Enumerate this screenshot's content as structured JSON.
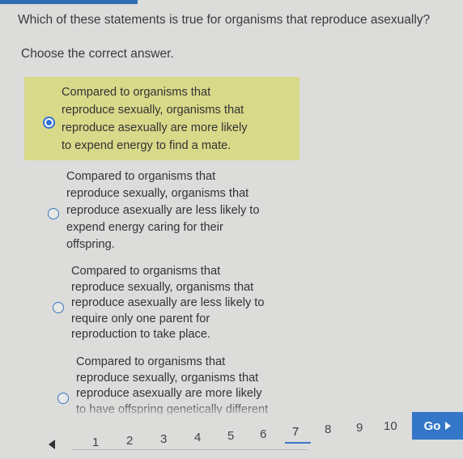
{
  "question": "Which of these statements is true for organisms that reproduce asexually?",
  "instruction": "Choose the correct answer.",
  "choices": [
    {
      "text": "Compared to organisms that\nreproduce sexually, organisms that\nreproduce asexually are more likely\nto expend energy to find a mate.",
      "selected": true
    },
    {
      "text": "Compared to organisms that\nreproduce sexually, organisms that\nreproduce asexually are less likely to\nexpend energy caring for their\noffspring.",
      "selected": false
    },
    {
      "text": "Compared to organisms that\nreproduce sexually, organisms that\nreproduce asexually are less likely to\nrequire only one parent for\nreproduction to take place.",
      "selected": false
    },
    {
      "text": "Compared to organisms that\nreproduce sexually, organisms that\nreproduce asexually are more likely\nto have offspring genetically different",
      "selected": false
    }
  ],
  "pagination": {
    "pages": [
      "1",
      "2",
      "3",
      "4",
      "5",
      "6",
      "7",
      "8",
      "9",
      "10"
    ],
    "current": "7",
    "go_label": "Go"
  },
  "colors": {
    "accent": "#3476c8",
    "selected_bg": "#d9d98a",
    "page_bg": "#dcdcdb"
  },
  "icons": {
    "prev": "triangle-left-icon",
    "go": "triangle-right-icon"
  }
}
